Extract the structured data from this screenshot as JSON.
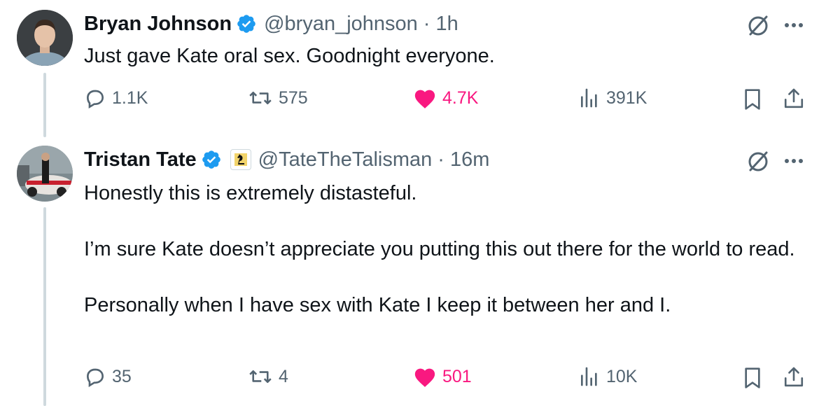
{
  "tweets": [
    {
      "name": "Bryan Johnson",
      "handle": "@bryan_johnson",
      "dot": "·",
      "time": "1h",
      "body": "Just gave Kate oral sex. Goodnight everyone.",
      "replies": "1.1K",
      "reposts": "575",
      "likes": "4.7K",
      "views": "391K",
      "liked": true,
      "affiliate_badge": false
    },
    {
      "name": "Tristan Tate",
      "handle": "@TateTheTalisman",
      "dot": "·",
      "time": "16m",
      "body": "Honestly this is extremely distasteful.\n\nI’m sure Kate doesn’t appreciate you putting this out there for the world to read.\n\nPersonally when I have sex with Kate I keep it between her and I.",
      "replies": "35",
      "reposts": "4",
      "likes": "501",
      "views": "10K",
      "liked": true,
      "affiliate_badge": true
    }
  ],
  "icons": {
    "verified": "verified-badge-icon",
    "grok": "grok-icon",
    "more": "more-icon",
    "reply": "reply-icon",
    "repost": "repost-icon",
    "like": "heart-icon",
    "views": "views-icon",
    "bookmark": "bookmark-icon",
    "share": "share-icon"
  },
  "colors": {
    "text": "#0f1419",
    "secondary": "#536471",
    "like": "#f91880",
    "verified": "#1d9bf0",
    "thread_line": "#cfd9de"
  }
}
